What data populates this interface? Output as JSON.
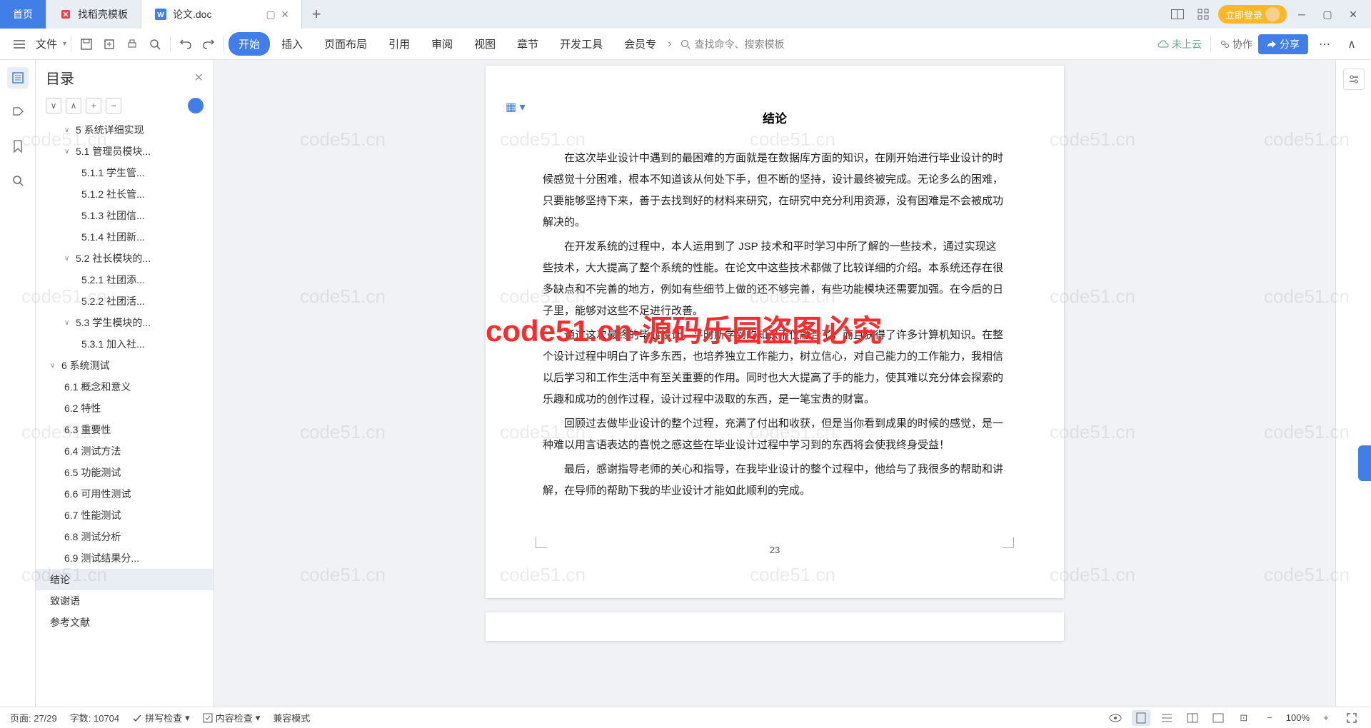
{
  "tabs": {
    "home": "首页",
    "template": "找稻壳模板",
    "doc": "论文.doc"
  },
  "window": {
    "login": "立即登录"
  },
  "ribbon": {
    "file": "文件",
    "menu": [
      "开始",
      "插入",
      "页面布局",
      "引用",
      "审阅",
      "视图",
      "章节",
      "开发工具",
      "会员专"
    ],
    "search_placeholder": "查找命令、搜索模板",
    "cloud": "未上云",
    "collab": "协作",
    "share": "分享"
  },
  "outline": {
    "title": "目录",
    "items": [
      {
        "lvl": 2,
        "chev": "∨",
        "txt": "5 系统详细实现"
      },
      {
        "lvl": 2,
        "chev": "∨",
        "txt": "5.1 管理员模块..."
      },
      {
        "lvl": 3,
        "txt": "5.1.1 学生管..."
      },
      {
        "lvl": 3,
        "txt": "5.1.2 社长管..."
      },
      {
        "lvl": 3,
        "txt": "5.1.3 社团信..."
      },
      {
        "lvl": 3,
        "txt": "5.1.4 社团新..."
      },
      {
        "lvl": 2,
        "chev": "∨",
        "txt": "5.2 社长模块的..."
      },
      {
        "lvl": 3,
        "txt": "5.2.1 社团添..."
      },
      {
        "lvl": 3,
        "txt": "5.2.2 社团活..."
      },
      {
        "lvl": 2,
        "chev": "∨",
        "txt": "5.3 学生模块的..."
      },
      {
        "lvl": 3,
        "txt": "5.3.1 加入社..."
      },
      {
        "lvl": 1,
        "chev": "∨",
        "txt": "6 系统测试"
      },
      {
        "lvl": 2,
        "txt": "6.1 概念和意义"
      },
      {
        "lvl": 2,
        "txt": "6.2 特性"
      },
      {
        "lvl": 2,
        "txt": "6.3 重要性"
      },
      {
        "lvl": 2,
        "txt": "6.4 测试方法"
      },
      {
        "lvl": 2,
        "txt": "6.5 功能测试"
      },
      {
        "lvl": 2,
        "txt": "6.6 可用性测试"
      },
      {
        "lvl": 2,
        "txt": "6.7 性能测试"
      },
      {
        "lvl": 2,
        "txt": "6.8 测试分析"
      },
      {
        "lvl": 2,
        "txt": "6.9 测试结果分..."
      },
      {
        "lvl": 1,
        "txt": "结论",
        "sel": true
      },
      {
        "lvl": 1,
        "txt": "致谢语"
      },
      {
        "lvl": 1,
        "txt": "参考文献"
      }
    ]
  },
  "document": {
    "heading": "结论",
    "paragraphs": [
      "在这次毕业设计中遇到的最困难的方面就是在数据库方面的知识，在刚开始进行毕业设计的时候感觉十分困难，根本不知道该从何处下手，但不断的坚持，设计最终被完成。无论多么的困难，只要能够坚持下来，善于去找到好的材料来研究，在研究中充分利用资源，没有困难是不会被成功解决的。",
      "在开发系统的过程中，本人运用到了 JSP 技术和平时学习中所了解的一些技术，通过实现这些技术，大大提高了整个系统的性能。在论文中这些技术都做了比较详细的介绍。本系统还存在很多缺点和不完善的地方，例如有些细节上做的还不够完善，有些功能模块还需要加强。在今后的日子里，能够对这些不足进行改善。",
      "通过这次最终的毕业设计，平时所学到的知识不仅融合了，而且获得了许多计算机知识。在整个设计过程中明白了许多东西，也培养独立工作能力，树立信心，对自己能力的工作能力，我相信以后学习和工作生活中有至关重要的作用。同时也大大提高了手的能力，使其难以充分体会探索的乐趣和成功的创作过程，设计过程中汲取的东西，是一笔宝贵的财富。",
      "回顾过去做毕业设计的整个过程，充满了付出和收获，但是当你看到成果的时候的感觉，是一种难以用言语表达的喜悦之感这些在毕业设计过程中学习到的东西将会使我终身受益！",
      "最后，感谢指导老师的关心和指导，在我毕业设计的整个过程中，他给与了我很多的帮助和讲解，在导师的帮助下我的毕业设计才能如此顺利的完成。"
    ],
    "page_number": "23"
  },
  "watermark": {
    "red": "code51.cn-源码乐园盗图必究",
    "gray": "code51.cn"
  },
  "status": {
    "page": "页面: 27/29",
    "words": "字数: 10704",
    "spell": "拼写检查",
    "content": "内容检查",
    "compat": "兼容模式",
    "zoom": "100%"
  }
}
